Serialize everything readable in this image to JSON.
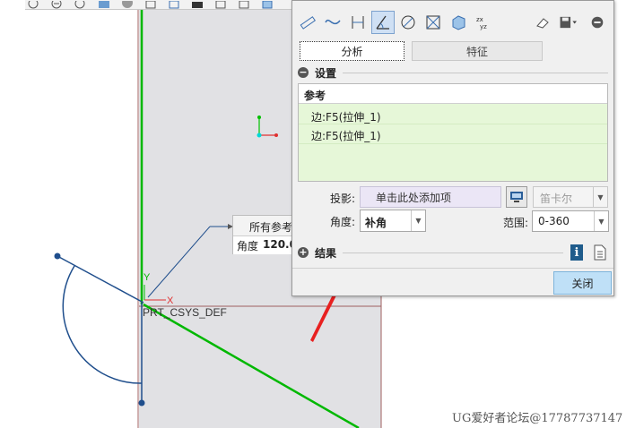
{
  "viewport": {
    "csys_label": "PRT_CSYS_DEF",
    "axis_x_label": "X",
    "axis_y_label": "Y",
    "colors": {
      "green_line": "#00b800",
      "blue_line": "#1f4e8c",
      "red": "#e03030"
    }
  },
  "top_toolbar": {
    "icons": [
      "zoom-fit-icon",
      "zoom-in-icon",
      "zoom-out-icon",
      "repaint-icon",
      "shading-icon",
      "view-orient-icon",
      "saved-view-icon",
      "screenshot-icon",
      "perspective-icon",
      "named-view-icon",
      "display-style-icon"
    ]
  },
  "callout": {
    "title": "所有参考",
    "angle_label": "角度",
    "angle_value": "120.0"
  },
  "dialog": {
    "toolbar_icons": [
      "measure-length-icon",
      "measure-curve-icon",
      "measure-distance-icon",
      "measure-angle-icon",
      "measure-diameter-icon",
      "measure-area-icon",
      "measure-volume-icon",
      "transform-icon",
      "eraser-icon",
      "save-icon",
      "collapse-icon"
    ],
    "tabs": {
      "analysis": "分析",
      "feature": "特征"
    },
    "settings_header": "设置",
    "references": {
      "header": "参考",
      "items": [
        "边:F5(拉伸_1)",
        "边:F5(拉伸_1)"
      ]
    },
    "projection": {
      "label": "投影:",
      "placeholder": "单击此处添加项",
      "coordinate_system": "笛卡尔"
    },
    "angle": {
      "label": "角度:",
      "value": "补角"
    },
    "range": {
      "label": "范围:",
      "value": "0-360"
    },
    "results_header": "结果",
    "close_label": "关闭"
  },
  "watermark": "UG爱好者论坛@17787737147"
}
